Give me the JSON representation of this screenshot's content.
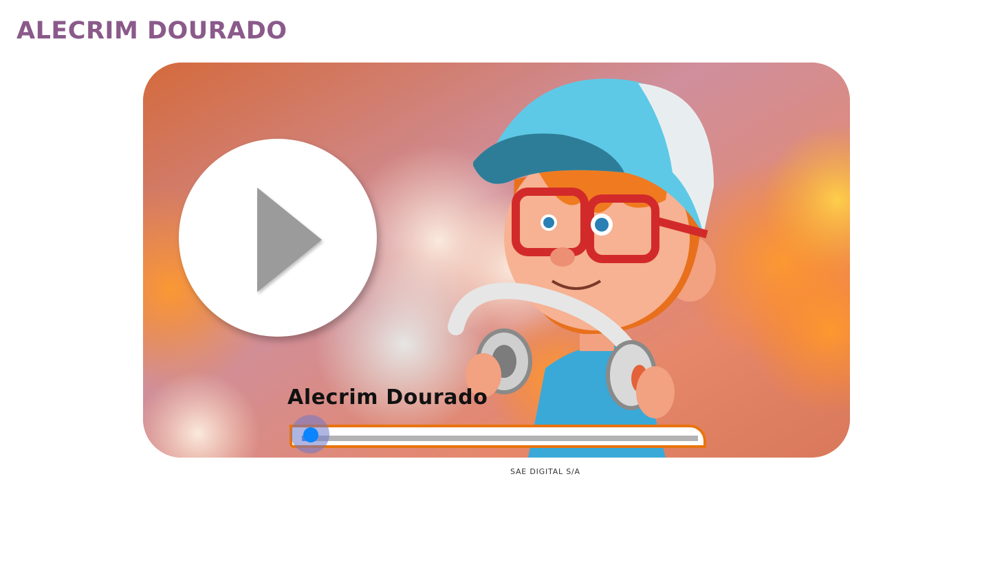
{
  "page": {
    "title": "ALECRIM DOURADO"
  },
  "player": {
    "media_title": "Alecrim Dourado",
    "play_icon": "play-icon",
    "progress_fraction": 0.02,
    "colors": {
      "accent": "#e8740f",
      "handle": "#0a84ff",
      "track": "#b3b3b3",
      "title_purple": "#8a5a8a"
    }
  },
  "footer": {
    "credit": "SAE DIGITAL S/A"
  }
}
